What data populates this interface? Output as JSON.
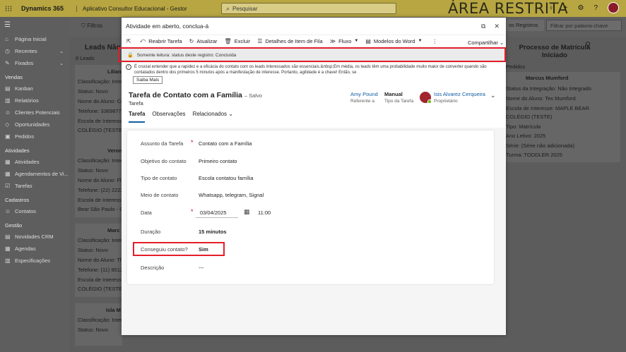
{
  "topbar": {
    "brand": "Dynamics 365",
    "app_name": "Aplicativo Consultor Educacional - Gestor",
    "search_placeholder": "Pesquisar",
    "banner": "ÁREA RESTRITA"
  },
  "sidebar": {
    "items_top": [
      {
        "label": "Página Inicial",
        "icon": "home-icon"
      },
      {
        "label": "Recentes",
        "icon": "clock-icon",
        "chevron": true
      },
      {
        "label": "Fixados",
        "icon": "pin-icon",
        "chevron": true
      }
    ],
    "groups": [
      {
        "title": "Vendas",
        "items": [
          "Kanban",
          "Relatórios",
          "Clientes Potenciais",
          "Oportunidades",
          "Pedidos"
        ]
      },
      {
        "title": "Atividades",
        "items": [
          "Atividades",
          "Agendamentos de Vi...",
          "Tarefas"
        ]
      },
      {
        "title": "Cadastros",
        "items": [
          "Contatos"
        ]
      },
      {
        "title": "Gestão",
        "items": [
          "Novidades CRM",
          "Agendas",
          "Especificações"
        ]
      }
    ]
  },
  "background": {
    "filtros": "Filtros",
    "leads_header": "Leads Não C",
    "leads_count": "8 Leads",
    "registros": "os Registros",
    "filter_placeholder": "Filtrar por palavra-chave",
    "right_title": "Processo de Matrícula Iniciado",
    "pedidos": "Pedidos",
    "cards": [
      {
        "name": "Lilian",
        "lines": [
          "Classificação: Intere",
          "Status: Novo",
          "Nome do Aluno: Ca",
          "Telefone: 33698779",
          "Escola de Interesse:",
          "COLÉGIO (TESTE)"
        ]
      },
      {
        "name": "Veron",
        "lines": [
          "Classificação: Intere",
          "Status: Novo",
          "Nome do Aluno: Flo",
          "Telefone: (22) 22222",
          "Escola de Interesse:",
          "Bear São Paulo - C"
        ]
      },
      {
        "name": "Marc",
        "lines": [
          "Classificação: Intere",
          "Status: Novo",
          "Nome do Aluno: The",
          "Telefone: (11) 9512",
          "Escola de Interesse:",
          "COLÉGIO (TESTE)"
        ]
      },
      {
        "name": "Isla M",
        "lines": [
          "Classificação: Intere",
          "Status: Novo"
        ]
      }
    ],
    "right_card": {
      "name": "Marcus Mumford",
      "lines": [
        "Status da Integração: Não Integrado",
        "Nome do Aluno: Tex Mumford",
        "Escola de Interesse: MAPLE BEAR",
        "COLÉGIO (TESTE)",
        "Tipo: Matrícula",
        "Ano Letivo: 2025",
        "Série: (Série não adicionada)",
        "Turma: TODDLER 2025"
      ]
    }
  },
  "dialog": {
    "title": "Atividade em aberto, conclua-á",
    "toolbar": [
      "Reabrir Tarefa",
      "Atualizar",
      "Excluir",
      "Detalhes de Item de Fila",
      "Fluxo",
      "Modelos do Word"
    ],
    "share": "Compartilhar",
    "readonly": "Somente leitura: status deste registro: Concluída",
    "notice": "É crucial entender que a rapidez e a eficácia do contato com os leads interessados são essenciais.&nbsp;Em média, os leads têm uma probabilidade muito maior de converter quando são contatados dentro dos primeiros 5 minutos após a manifestação de interesse. Portanto, agilidade é a chave! Então, se",
    "saiba_mais": "Saiba Mais",
    "record_title": "Tarefa de Contato com a Família",
    "record_saved": "– Salvo",
    "record_type": "Tarefa",
    "header_fields": [
      {
        "value": "Amy Pound",
        "label": "Referente a"
      },
      {
        "value": "Manual",
        "label": "Tipo da Tarefa"
      },
      {
        "value": "Isis Alvarez Cerqueira",
        "label": "Proprietário"
      }
    ],
    "tabs": [
      "Tarefa",
      "Observações",
      "Relacionados"
    ],
    "fields": [
      {
        "label": "Assunto da Tarefa",
        "value": "Contato com a Família",
        "required": true
      },
      {
        "label": "Objetivo do contato",
        "value": "Primeiro contato",
        "required": false
      },
      {
        "label": "Tipo de contato",
        "value": "Escola contatou família",
        "required": false
      },
      {
        "label": "Meio de contato",
        "value": "Whatsapp, telegram, Signal",
        "required": false
      },
      {
        "label": "Data",
        "value": "03/04/2025",
        "time": "11:00",
        "required": true
      },
      {
        "label": "Duração",
        "value": "15 minutos",
        "required": false
      },
      {
        "label": "Conseguiu contato?",
        "value": "Sim",
        "required": false
      },
      {
        "label": "Descrição",
        "value": "---",
        "required": false
      }
    ]
  }
}
